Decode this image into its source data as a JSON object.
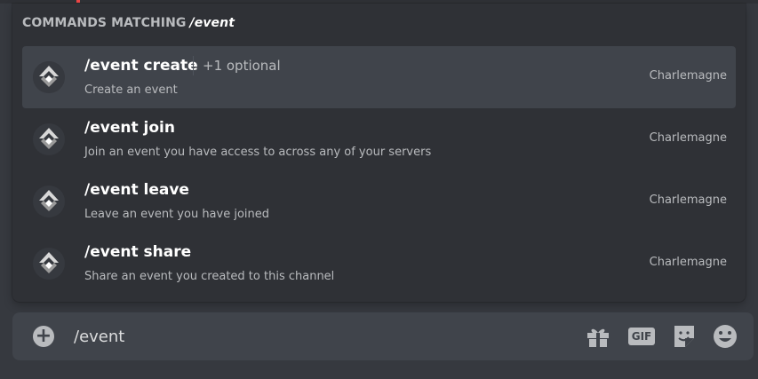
{
  "header": {
    "prefix": "COMMANDS MATCHING",
    "query": "/event"
  },
  "commands": [
    {
      "name": "/event create",
      "optional": "+1 optional",
      "description": "Create an event",
      "bot": "Charlemagne"
    },
    {
      "name": "/event join",
      "description": "Join an event you have access to across any of your servers",
      "bot": "Charlemagne"
    },
    {
      "name": "/event leave",
      "description": "Leave an event you have joined",
      "bot": "Charlemagne"
    },
    {
      "name": "/event share",
      "description": "Share an event you created to this channel",
      "bot": "Charlemagne"
    }
  ],
  "composer": {
    "value": "/event",
    "add_icon": "plus-circle-icon",
    "tools": [
      "gift-icon",
      "gif-icon",
      "sticker-icon",
      "emoji-icon"
    ],
    "gif_label": "GIF"
  },
  "colors": {
    "background": "#36393f",
    "popup": "#2f3136",
    "selected_row": "#40444b",
    "composer": "#40444b",
    "muted_text": "#b9bbbe",
    "accent": "#f04747"
  }
}
